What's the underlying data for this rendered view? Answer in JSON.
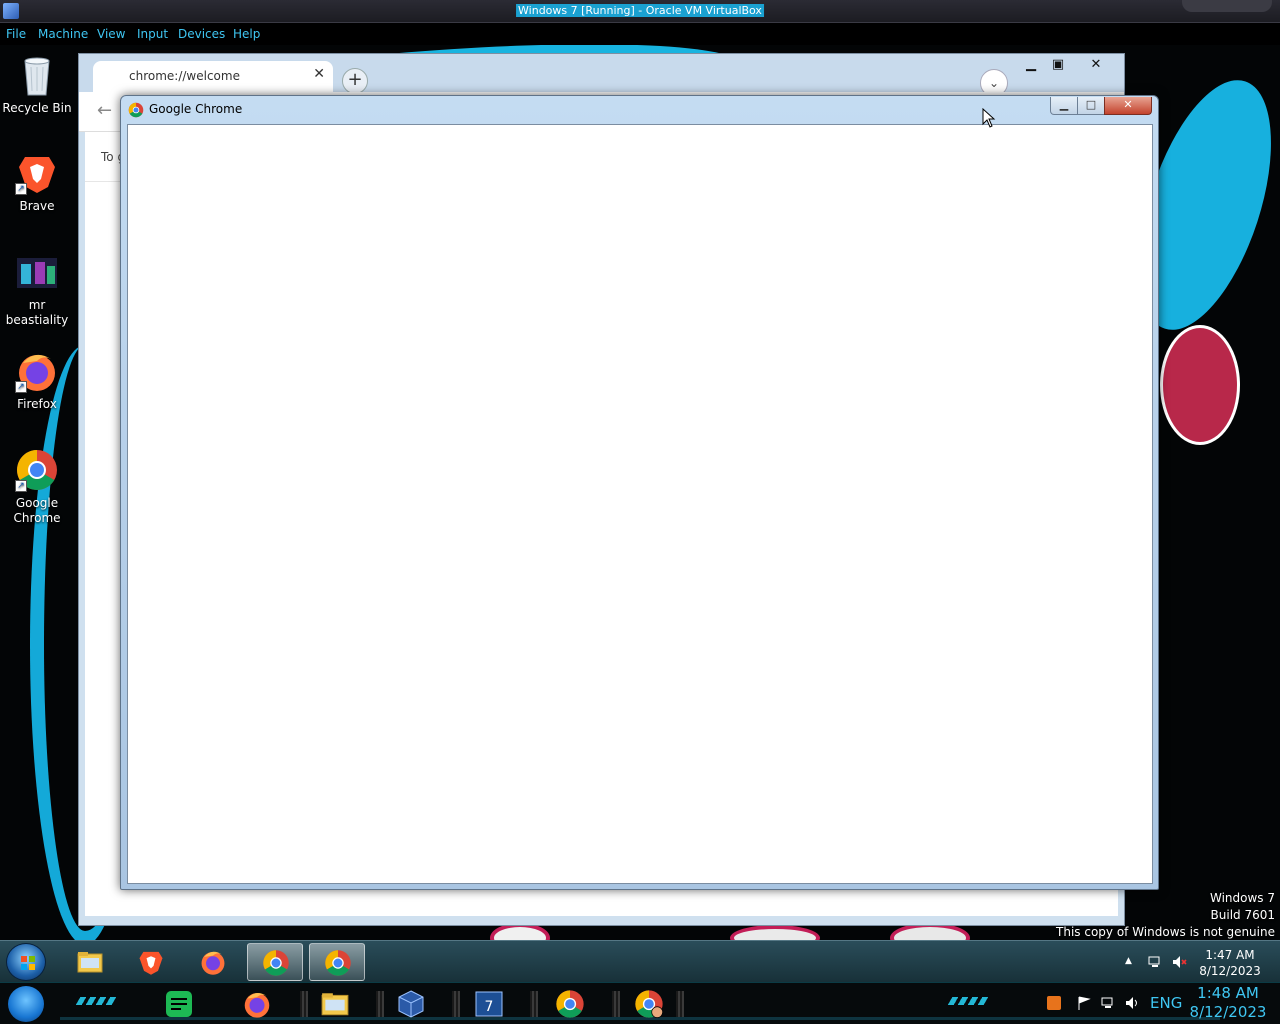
{
  "host": {
    "title": "Windows 7 [Running] - Oracle VM VirtualBox",
    "menu": [
      "File",
      "Machine",
      "View",
      "Input",
      "Devices",
      "Help"
    ],
    "tray": {
      "language": "ENG",
      "time": "1:48 AM",
      "date": "8/12/2023"
    },
    "accent_color": "#3fc6f2",
    "taskbar_icons": [
      "windows-orb-icon",
      "notes-app-icon",
      "firefox-icon",
      "file-explorer-icon",
      "virtualbox-icon",
      "windows7-vm-icon",
      "chrome-icon",
      "chrome-profile-icon"
    ]
  },
  "desktop": {
    "icons": [
      {
        "label": "Recycle Bin",
        "icon": "recycle-bin-icon"
      },
      {
        "label": "Brave",
        "icon": "brave-icon"
      },
      {
        "label": "mr beastiality",
        "icon": "image-thumbnail-icon"
      },
      {
        "label": "Firefox",
        "icon": "firefox-icon"
      },
      {
        "label": "Google Chrome",
        "icon": "chrome-icon"
      }
    ],
    "watermark": {
      "line1": "Windows 7",
      "line2": "Build 7601",
      "line3": "This copy of Windows is not genuine"
    }
  },
  "background_window": {
    "tab_title": "chrome://welcome",
    "infobar_text": "To g"
  },
  "foreground_window": {
    "title": "Google Chrome",
    "minimize_glyph": "▁",
    "maximize_glyph": "□",
    "close_glyph": "✕"
  },
  "guest_taskbar": {
    "clock_time": "1:47 AM",
    "clock_date": "8/12/2023",
    "pinned": [
      "file-explorer-icon",
      "brave-icon",
      "firefox-icon",
      "chrome-icon",
      "chrome-icon"
    ]
  }
}
